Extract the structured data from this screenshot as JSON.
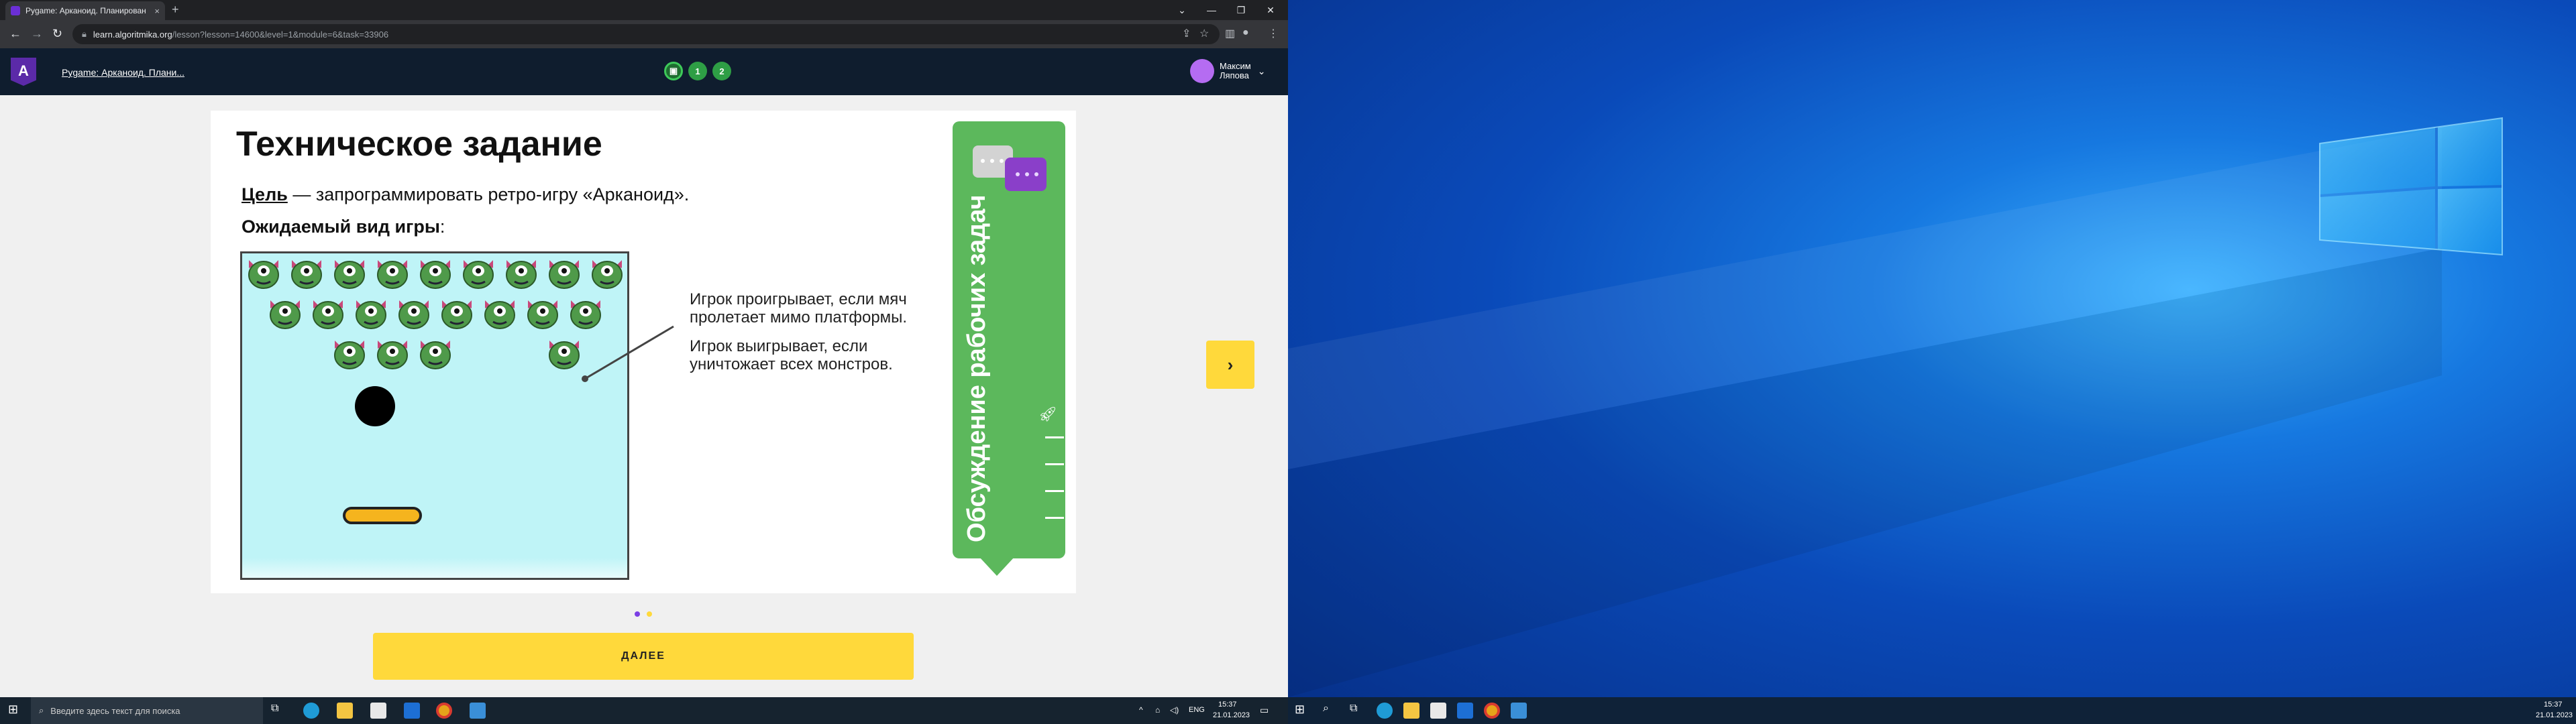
{
  "browser": {
    "tab_title": "Pygame: Арканоид. Планирован",
    "tab_close": "×",
    "new_tab": "+",
    "url_host": "learn.algoritmika.org",
    "url_path": "/lesson?lesson=14600&level=1&module=6&task=33906"
  },
  "site": {
    "logo_letter": "A",
    "breadcrumb": "Pygame: Арканоид. Плани...",
    "steps": [
      "1",
      "2"
    ],
    "user_first": "Максим",
    "user_last": "Ляпова"
  },
  "lesson": {
    "title": "Техническое задание",
    "goal_label": "Цель",
    "goal_text": " — запрограммировать ретро-игру «Арканоид».",
    "expected_label": "Ожидаемый вид игры",
    "expected_colon": ":",
    "note_lose": "Игрок проигрывает, если мяч пролетает мимо платформы.",
    "note_win": "Игрок выигрывает, если уничтожает всех монстров.",
    "panel_text": "Обсуждение рабочих задач",
    "next_arrow": "›",
    "next_button": "ДАЛЕЕ"
  },
  "colors": {
    "accent_yellow": "#ffd93b",
    "panel_green": "#5cb85c",
    "header_dark": "#0f1d2e",
    "brand_purple": "#5b2aa8",
    "dot_active": "#7b3fe4",
    "dot_inactive": "#ffd93b"
  },
  "taskbar_left": {
    "search_placeholder": "Введите здесь текст для поиска",
    "lang": "ENG",
    "time": "15:37",
    "date": "21.01.2023"
  },
  "taskbar_right": {
    "time": "15:37",
    "date": "21.01.2023"
  },
  "icons": [
    "windows-start-icon",
    "search-icon",
    "task-view-icon",
    "edge-icon",
    "explorer-icon",
    "store-icon",
    "mail-icon",
    "chrome-icon",
    "app-icon",
    "notification-icon"
  ]
}
